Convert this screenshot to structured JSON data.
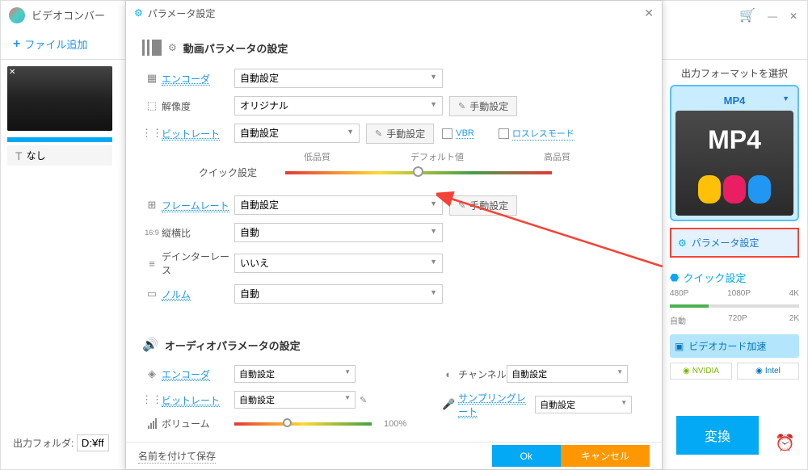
{
  "main": {
    "title": "ビデオコンバー",
    "add_file": "ファイル追加",
    "item_none": "なし",
    "output_folder_label": "出力フォルダ:",
    "output_folder_value": "D:¥ff",
    "convert": "変換"
  },
  "right": {
    "header": "出力フォーマットを選択",
    "format": "MP4",
    "format_img_text": "MP4",
    "param_btn": "パラメータ設定",
    "quick_title": "クイック設定",
    "quality_top": [
      "480P",
      "1080P",
      "4K"
    ],
    "quality_bottom": [
      "自動",
      "720P",
      "2K"
    ],
    "video_card": "ビデオカード加速",
    "nvidia": "NVIDIA",
    "intel": "Intel"
  },
  "dialog": {
    "title": "パラメータ設定",
    "video_section": "動画パラメータの設定",
    "encoder_label": "エンコーダ",
    "encoder_value": "自動設定",
    "resolution_label": "解像度",
    "resolution_value": "オリジナル",
    "manual_btn": "手動設定",
    "bitrate_label": "ビットレート",
    "bitrate_value": "自動設定",
    "vbr": "VBR",
    "lossless": "ロスレスモード",
    "low_quality": "低品質",
    "default_val": "デフォルト値",
    "high_quality": "高品質",
    "quick_set": "クイック設定",
    "framerate_label": "フレームレート",
    "framerate_value": "自動設定",
    "aspect_label": "縦横比",
    "aspect_value": "自動",
    "deinterlace_label": "デインターレース",
    "deinterlace_value": "いいえ",
    "norm_label": "ノルム",
    "norm_value": "自動",
    "audio_section": "オーディオパラメータの設定",
    "audio_encoder_label": "エンコーダ",
    "audio_encoder_value": "自動設定",
    "audio_bitrate_label": "ビットレート",
    "audio_bitrate_value": "自動設定",
    "volume_label": "ボリューム",
    "volume_value": "100%",
    "channel_label": "チャンネル",
    "channel_value": "自動設定",
    "samplerate_label": "サンプリングレート",
    "samplerate_value": "自動設定",
    "save_as": "名前を付けて保存",
    "ok": "Ok",
    "cancel": "キャンセル"
  }
}
